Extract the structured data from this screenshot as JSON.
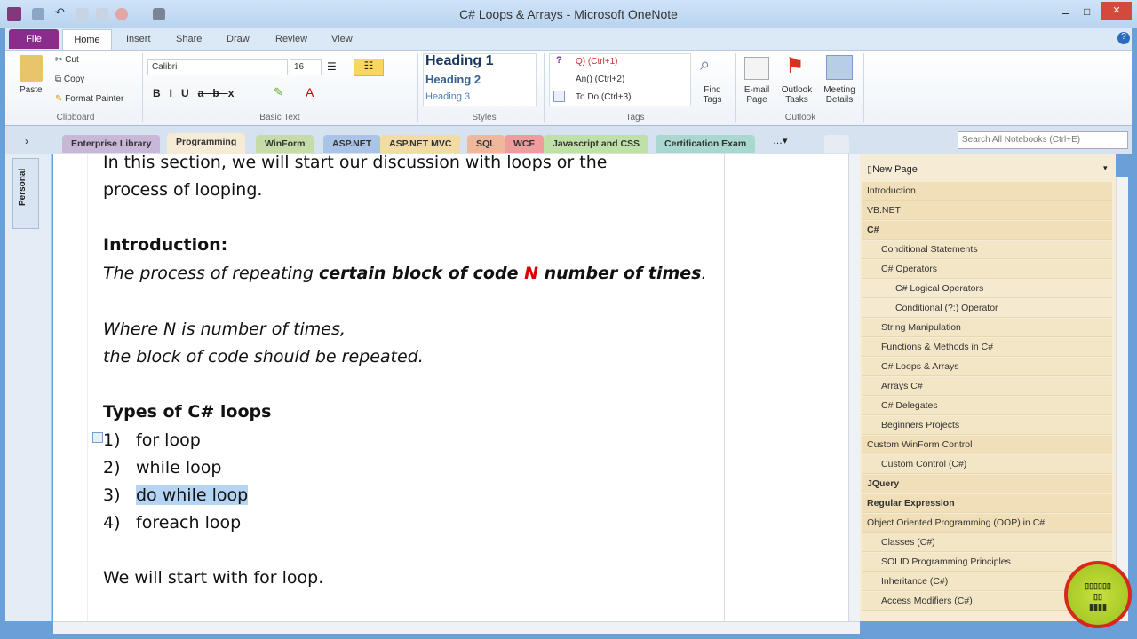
{
  "window": {
    "title": "C# Loops & Arrays - Microsoft OneNote",
    "minimize": "–",
    "maximize": "□",
    "close": "✕"
  },
  "ribbon_tabs": [
    "File",
    "Home",
    "Insert",
    "Share",
    "Draw",
    "Review",
    "View"
  ],
  "clipboard": {
    "paste": "Paste",
    "cut": "Cut",
    "copy": "Copy",
    "format_painter": "Format Painter",
    "group": "Clipboard"
  },
  "basic_text": {
    "font": "Calibri",
    "size": "16",
    "group": "Basic Text"
  },
  "styles": {
    "h1": "Heading 1",
    "h2": "Heading 2",
    "h3": "Heading 3",
    "group": "Styles"
  },
  "tags": {
    "t1": "Q) (Ctrl+1)",
    "t2": "An() (Ctrl+2)",
    "t3": "To Do (Ctrl+3)",
    "find": "Find Tags",
    "group": "Tags"
  },
  "outlook": {
    "email": "E-mail Page",
    "tasks": "Outlook Tasks",
    "meeting": "Meeting Details",
    "group": "Outlook"
  },
  "sections": [
    {
      "label": "Enterprise Library",
      "color": "#c9b7d8"
    },
    {
      "label": "Programming",
      "color": "#f6ecd6"
    },
    {
      "label": "WinForm",
      "color": "#c6dca8"
    },
    {
      "label": "ASP.NET",
      "color": "#a9c4e6"
    },
    {
      "label": "ASP.NET MVC",
      "color": "#f2dca4"
    },
    {
      "label": "SQL",
      "color": "#f0b89a"
    },
    {
      "label": "WCF",
      "color": "#ee9c9c"
    },
    {
      "label": "Javascript and CSS",
      "color": "#bfe0a6"
    },
    {
      "label": "Certification Exam",
      "color": "#a8d8d0"
    }
  ],
  "search": {
    "placeholder": "Search All Notebooks (Ctrl+E)"
  },
  "notebook": "Personal",
  "content": {
    "intro1": "In this section, we will start our discussion with loops or the",
    "intro2": "process of looping.",
    "heading": "Introduction:",
    "def_a": "The process of repeating ",
    "def_b": "certain block of code ",
    "def_n": "N",
    "def_c": " number of times",
    "def_d": ".",
    "where1": "Where N is number of times,",
    "where2": "the block of code should be repeated.",
    "types": "Types of C# loops",
    "loops": [
      {
        "n": "1)",
        "t": "for loop"
      },
      {
        "n": "2)",
        "t": "while loop"
      },
      {
        "n": "3)",
        "t": "do while loop"
      },
      {
        "n": "4)",
        "t": "foreach  loop"
      }
    ],
    "closing": "We will start with for loop."
  },
  "pages": {
    "new_page": "New Page",
    "items": [
      {
        "label": "Introduction",
        "level": 0
      },
      {
        "label": "VB.NET",
        "level": 0
      },
      {
        "label": "C#",
        "level": 0,
        "bold": true
      },
      {
        "label": "Conditional Statements",
        "level": 1
      },
      {
        "label": "C# Operators",
        "level": 1
      },
      {
        "label": "C# Logical Operators",
        "level": 2
      },
      {
        "label": "Conditional (?:) Operator",
        "level": 2
      },
      {
        "label": "String Manipulation",
        "level": 1
      },
      {
        "label": "Functions & Methods in C#",
        "level": 1
      },
      {
        "label": "C# Loops & Arrays",
        "level": 1,
        "selected": true
      },
      {
        "label": "Arrays C#",
        "level": 1
      },
      {
        "label": "C# Delegates",
        "level": 1
      },
      {
        "label": "Beginners Projects",
        "level": 1
      },
      {
        "label": "Custom WinForm Control",
        "level": 0
      },
      {
        "label": "Custom Control (C#)",
        "level": 1
      },
      {
        "label": "JQuery",
        "level": 0,
        "bold": true
      },
      {
        "label": "Regular Expression",
        "level": 0,
        "bold": true
      },
      {
        "label": "Object Oriented Programming (OOP) in C#",
        "level": 0
      },
      {
        "label": "Classes (C#)",
        "level": 1
      },
      {
        "label": "SOLID Programming Principles",
        "level": 1
      },
      {
        "label": "Inheritance (C#)",
        "level": 1
      },
      {
        "label": "Access Modifiers (C#)",
        "level": 1
      }
    ]
  }
}
